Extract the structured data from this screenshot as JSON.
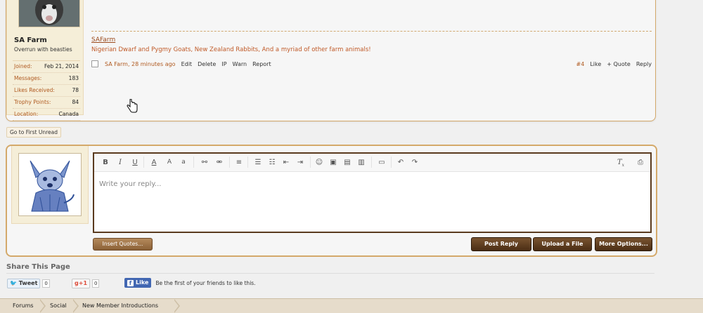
{
  "post": {
    "user": {
      "name": "SA Farm",
      "title": "Overrun with beasties",
      "stats": [
        {
          "label": "Joined:",
          "value": "Feb 21, 2014"
        },
        {
          "label": "Messages:",
          "value": "183"
        },
        {
          "label": "Likes Received:",
          "value": "78"
        },
        {
          "label": "Trophy Points:",
          "value": "84"
        },
        {
          "label": "Location:",
          "value": "Canada"
        }
      ]
    },
    "signature": {
      "name": "SAFarm",
      "text": "Nigerian Dwarf and Pygmy Goats, New Zealand Rabbits, And a myriad of other farm animals!"
    },
    "meta": {
      "author_time": "SA Farm, 28 minutes ago",
      "links": [
        "Edit",
        "Delete",
        "IP",
        "Warn",
        "Report"
      ],
      "post_number": "#4",
      "actions": [
        "Like",
        "+ Quote",
        "Reply"
      ]
    }
  },
  "go_to_first_unread": "Go to First Unread",
  "reply": {
    "placeholder": "Write your reply...",
    "insert_quotes": "Insert Quotes...",
    "post_reply": "Post Reply",
    "upload_file": "Upload a File",
    "more_options": "More Options..."
  },
  "toolbar": {
    "bold": "B",
    "italic": "I",
    "underline": "U",
    "font_color": "A",
    "font_size": "A",
    "font_family": "a",
    "remove_format": "T"
  },
  "share": {
    "title": "Share This Page",
    "tweet": "Tweet",
    "tweet_count": "0",
    "gplus": "+1",
    "gplus_count": "0",
    "fb_like": "Like",
    "fb_text": "Be the first of your friends to like this."
  },
  "breadcrumb": [
    "Forums",
    "Social",
    "New Member Introductions"
  ],
  "colors": {
    "border": "#d4a96a",
    "link_orange": "#b05a20",
    "button_dark": "#4a2d14",
    "facebook": "#4267b2",
    "twitter": "#2aa3ef"
  }
}
